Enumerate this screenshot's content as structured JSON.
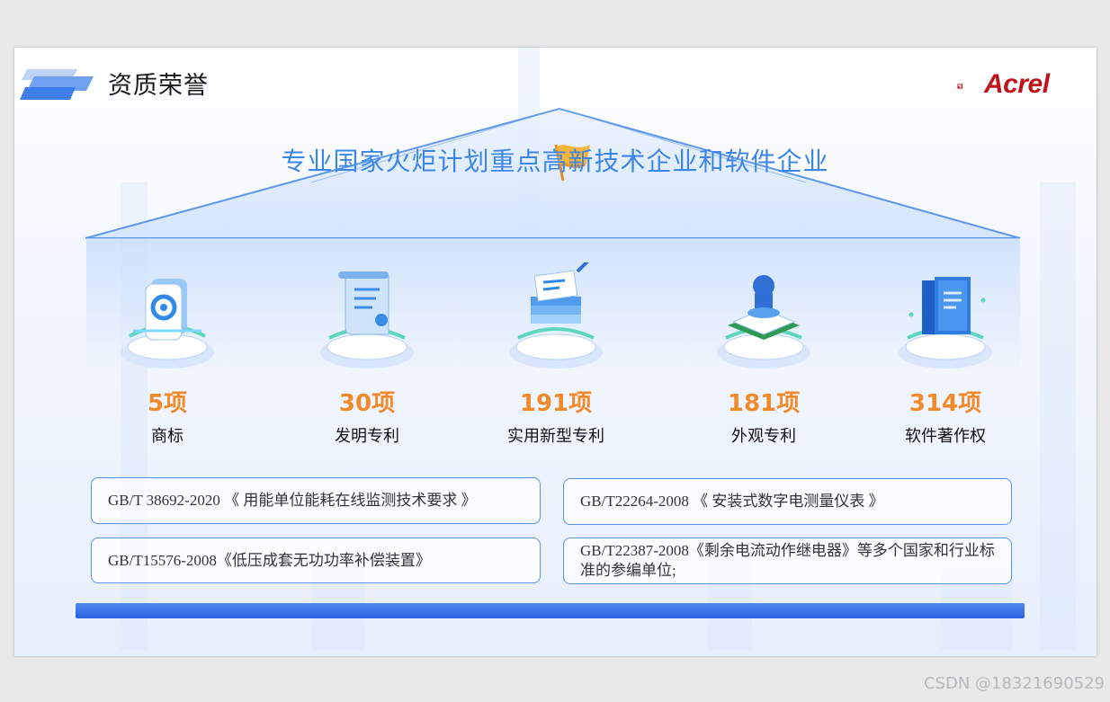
{
  "header": {
    "title": "资质荣誉",
    "logo_text": "Acrel"
  },
  "headline": "专业国家火炬计划重点高新技术企业和软件企业",
  "stats": [
    {
      "number": "5项",
      "label": "商标",
      "icon": "trademark-icon"
    },
    {
      "number": "30项",
      "label": "发明专利",
      "icon": "scroll-document-icon"
    },
    {
      "number": "191项",
      "label": "实用新型专利",
      "icon": "paper-stack-icon"
    },
    {
      "number": "181项",
      "label": "外观专利",
      "icon": "stamp-icon"
    },
    {
      "number": "314项",
      "label": "软件著作权",
      "icon": "books-icon"
    }
  ],
  "standards": [
    "GB/T 38692-2020 《 用能单位能耗在线监测技术要求 》",
    "GB/T22264-2008 《 安装式数字电测量仪表 》",
    "GB/T15576-2008《低压成套无功功率补偿装置》",
    "GB/T22387-2008《剩余电流动作继电器》等多个国家和行业标准的参编单位;"
  ],
  "watermark": "CSDN @18321690529",
  "colors": {
    "accent_blue": "#3b86e8",
    "stat_orange": "#f08a2a",
    "logo_red": "#c0141c",
    "base_bar": "#2a63dd"
  }
}
